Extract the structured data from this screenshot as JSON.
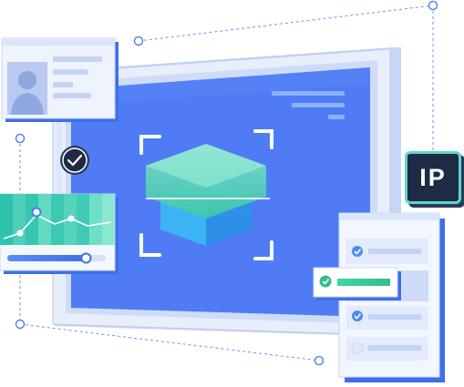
{
  "badge": {
    "label": "IP"
  },
  "chart_card": {
    "slider_level": 0.8
  },
  "checklist": {
    "item_count": 4,
    "highlighted_index": 1
  },
  "colors": {
    "screen": "#4f7cf5",
    "frame": "#dfe8fb",
    "accent_teal": "#4fd6b4",
    "accent_blue": "#4a8df0",
    "badge_bg": "#1f2a44"
  }
}
